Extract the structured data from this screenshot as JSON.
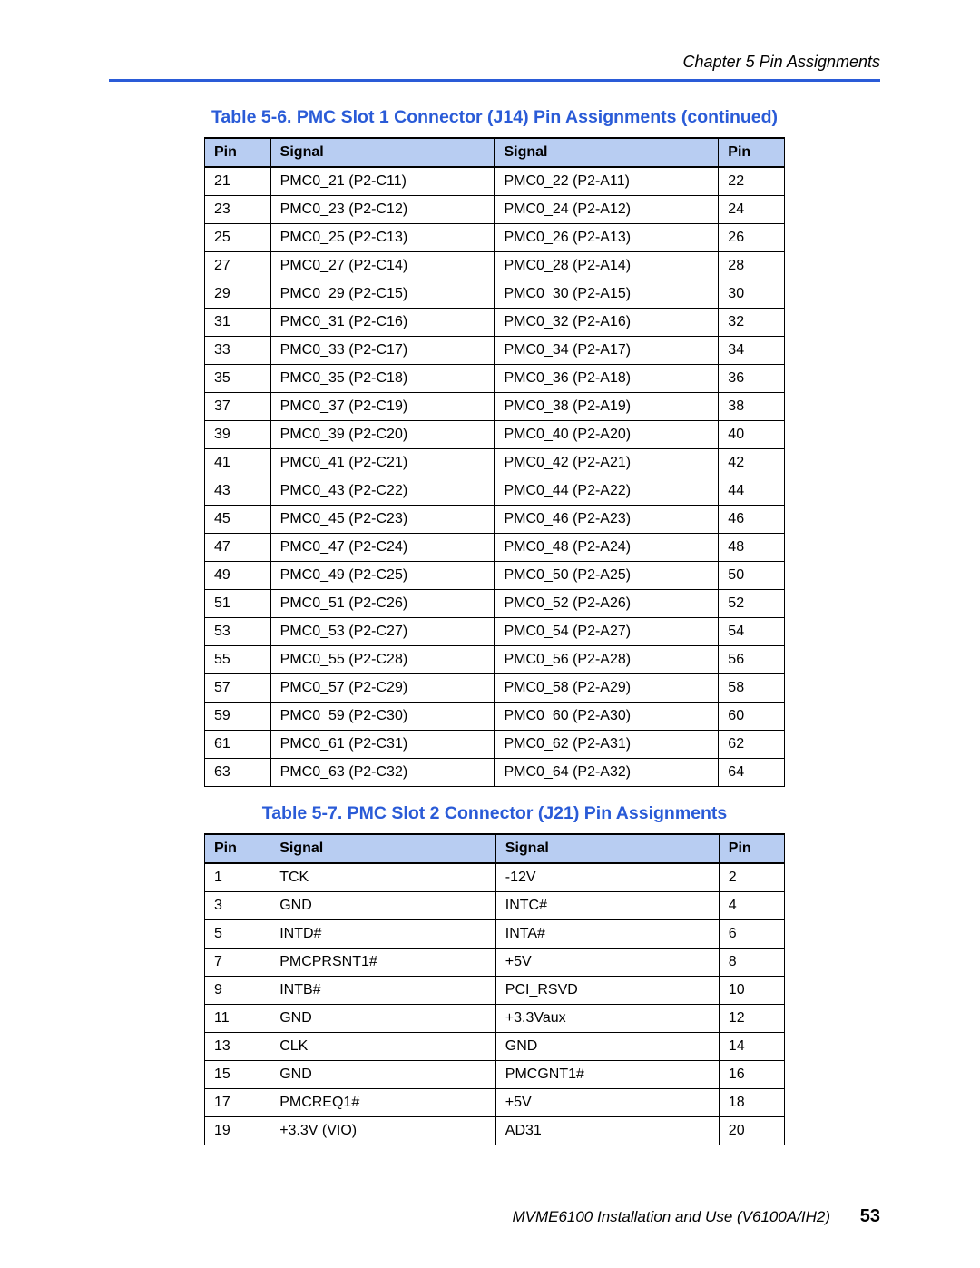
{
  "header": {
    "chapter": "Chapter 5  Pin Assignments"
  },
  "tables": [
    {
      "caption": "Table 5-6. PMC Slot 1 Connector (J14) Pin Assignments (continued)",
      "columns": [
        "Pin",
        "Signal",
        "Signal",
        "Pin"
      ],
      "rows": [
        [
          "21",
          "PMC0_21 (P2-C11)",
          "PMC0_22 (P2-A11)",
          "22"
        ],
        [
          "23",
          "PMC0_23 (P2-C12)",
          "PMC0_24 (P2-A12)",
          "24"
        ],
        [
          "25",
          "PMC0_25 (P2-C13)",
          "PMC0_26 (P2-A13)",
          "26"
        ],
        [
          "27",
          "PMC0_27 (P2-C14)",
          "PMC0_28 (P2-A14)",
          "28"
        ],
        [
          "29",
          "PMC0_29 (P2-C15)",
          "PMC0_30 (P2-A15)",
          "30"
        ],
        [
          "31",
          "PMC0_31 (P2-C16)",
          "PMC0_32 (P2-A16)",
          "32"
        ],
        [
          "33",
          "PMC0_33 (P2-C17)",
          "PMC0_34 (P2-A17)",
          "34"
        ],
        [
          "35",
          "PMC0_35 (P2-C18)",
          "PMC0_36 (P2-A18)",
          "36"
        ],
        [
          "37",
          "PMC0_37 (P2-C19)",
          "PMC0_38 (P2-A19)",
          "38"
        ],
        [
          "39",
          "PMC0_39 (P2-C20)",
          "PMC0_40 (P2-A20)",
          "40"
        ],
        [
          "41",
          "PMC0_41 (P2-C21)",
          "PMC0_42 (P2-A21)",
          "42"
        ],
        [
          "43",
          "PMC0_43 (P2-C22)",
          "PMC0_44 (P2-A22)",
          "44"
        ],
        [
          "45",
          "PMC0_45 (P2-C23)",
          "PMC0_46 (P2-A23)",
          "46"
        ],
        [
          "47",
          "PMC0_47 (P2-C24)",
          "PMC0_48 (P2-A24)",
          "48"
        ],
        [
          "49",
          "PMC0_49 (P2-C25)",
          "PMC0_50 (P2-A25)",
          "50"
        ],
        [
          "51",
          "PMC0_51 (P2-C26)",
          "PMC0_52 (P2-A26)",
          "52"
        ],
        [
          "53",
          "PMC0_53 (P2-C27)",
          "PMC0_54 (P2-A27)",
          "54"
        ],
        [
          "55",
          "PMC0_55 (P2-C28)",
          "PMC0_56 (P2-A28)",
          "56"
        ],
        [
          "57",
          "PMC0_57 (P2-C29)",
          "PMC0_58 (P2-A29)",
          "58"
        ],
        [
          "59",
          "PMC0_59 (P2-C30)",
          "PMC0_60 (P2-A30)",
          "60"
        ],
        [
          "61",
          "PMC0_61 (P2-C31)",
          "PMC0_62 (P2-A31)",
          "62"
        ],
        [
          "63",
          "PMC0_63 (P2-C32)",
          "PMC0_64 (P2-A32)",
          "64"
        ]
      ]
    },
    {
      "caption": "Table 5-7. PMC Slot 2 Connector (J21) Pin Assignments",
      "columns": [
        "Pin",
        "Signal",
        "Signal",
        "Pin"
      ],
      "rows": [
        [
          "1",
          "TCK",
          "-12V",
          "2"
        ],
        [
          "3",
          "GND",
          "INTC#",
          "4"
        ],
        [
          "5",
          "INTD#",
          "INTA#",
          "6"
        ],
        [
          "7",
          "PMCPRSNT1#",
          "+5V",
          "8"
        ],
        [
          "9",
          "INTB#",
          "PCI_RSVD",
          "10"
        ],
        [
          "11",
          "GND",
          "+3.3Vaux",
          "12"
        ],
        [
          "13",
          "CLK",
          "GND",
          "14"
        ],
        [
          "15",
          "GND",
          "PMCGNT1#",
          "16"
        ],
        [
          "17",
          "PMCREQ1#",
          "+5V",
          "18"
        ],
        [
          "19",
          "+3.3V (VIO)",
          "AD31",
          "20"
        ]
      ]
    }
  ],
  "footer": {
    "doc": "MVME6100 Installation and Use (V6100A/IH2)",
    "page": "53"
  }
}
